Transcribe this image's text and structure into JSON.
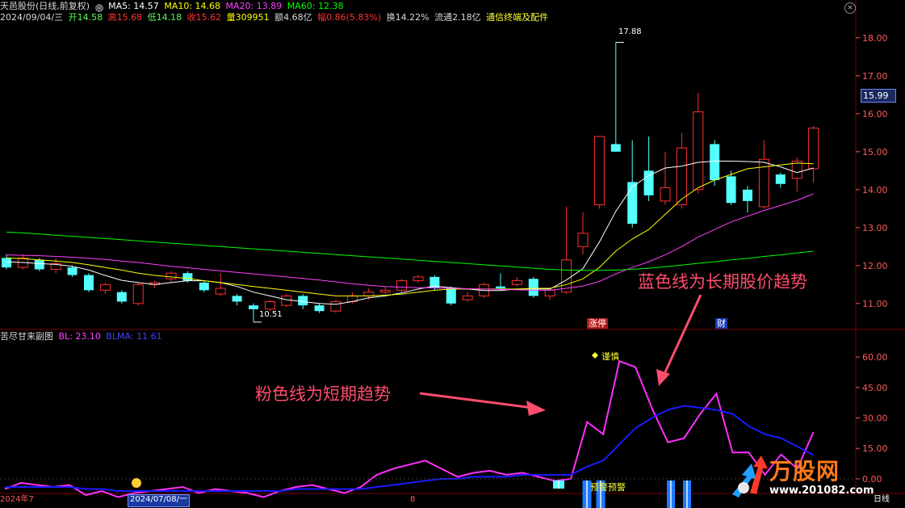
{
  "header": {
    "stock_name": "天邑股份(日线,前复权)",
    "ma5": "MA5: 14.57",
    "ma10": "MA10: 14.68",
    "ma20": "MA20: 13.89",
    "ma60": "MA60: 12.38",
    "date": "2024/09/04/三",
    "open": "开14.58",
    "high": "高15.68",
    "low": "低14.18",
    "close": "收15.62",
    "volume": "量309951",
    "amount": "额4.68亿",
    "change": "幅0.86(5.83%)",
    "turnover": "换14.22%",
    "float": "流通2.18亿",
    "sector": "通信终端及配件"
  },
  "sub_header": {
    "name": "苦尽甘来副图",
    "bl": "BL: 23.10",
    "blma": "BLMA: 11.61"
  },
  "labels": {
    "high_price": "17.88",
    "low_price": "10.51",
    "current_price": "15.99",
    "limit_up": "涨停",
    "finance": "财",
    "caution": "谨慎",
    "warning": "预警预警",
    "annot_blue": "蓝色线为长期股价趋势",
    "annot_pink": "粉色线为短期趋势",
    "close_symbol": "×",
    "ma_dot": "○"
  },
  "axis_bottom": {
    "date1": "2024年7",
    "date2": "2024/07/08/一",
    "date3": "8",
    "period": "日线"
  },
  "logo": {
    "text": "万股网",
    "url": "www.201082.com"
  },
  "colors": {
    "ma5": "#ffffff",
    "ma10": "#ffff00",
    "ma20": "#ff40ff",
    "ma60": "#00ff00",
    "up": "#ff3030",
    "down": "#54ffff",
    "bl": "#ff30ff",
    "blma": "#1a1aff",
    "grid": "#7a0000",
    "axis_text": "#ff5a5a"
  },
  "chart_data": [
    {
      "type": "candlestick",
      "title": "天邑股份(日线,前复权)",
      "y_ticks": [
        11.0,
        12.0,
        13.0,
        14.0,
        15.0,
        16.0,
        17.0,
        18.0
      ],
      "ylim": [
        10.4,
        18.4
      ],
      "candles": [
        {
          "o": 12.2,
          "c": 11.95,
          "h": 12.3,
          "l": 11.9
        },
        {
          "o": 11.95,
          "c": 12.2,
          "h": 12.3,
          "l": 11.9
        },
        {
          "o": 12.15,
          "c": 11.9,
          "h": 12.2,
          "l": 11.85
        },
        {
          "o": 11.9,
          "c": 12.05,
          "h": 12.2,
          "l": 11.8
        },
        {
          "o": 11.95,
          "c": 11.75,
          "h": 12.0,
          "l": 11.7
        },
        {
          "o": 11.75,
          "c": 11.35,
          "h": 11.8,
          "l": 11.3
        },
        {
          "o": 11.35,
          "c": 11.5,
          "h": 11.55,
          "l": 11.25
        },
        {
          "o": 11.3,
          "c": 11.05,
          "h": 11.35,
          "l": 11.0
        },
        {
          "o": 11.0,
          "c": 11.5,
          "h": 11.55,
          "l": 10.95
        },
        {
          "o": 11.5,
          "c": 11.55,
          "h": 11.6,
          "l": 11.4
        },
        {
          "o": 11.65,
          "c": 11.8,
          "h": 11.85,
          "l": 11.55
        },
        {
          "o": 11.8,
          "c": 11.6,
          "h": 11.85,
          "l": 11.55
        },
        {
          "o": 11.55,
          "c": 11.35,
          "h": 11.6,
          "l": 11.3
        },
        {
          "o": 11.25,
          "c": 11.4,
          "h": 11.8,
          "l": 11.2
        },
        {
          "o": 11.2,
          "c": 11.05,
          "h": 11.25,
          "l": 10.95
        },
        {
          "o": 10.95,
          "c": 10.85,
          "h": 11.0,
          "l": 10.51
        },
        {
          "o": 10.85,
          "c": 11.05,
          "h": 11.1,
          "l": 10.8
        },
        {
          "o": 10.95,
          "c": 11.2,
          "h": 11.25,
          "l": 10.9
        },
        {
          "o": 11.2,
          "c": 10.95,
          "h": 11.25,
          "l": 10.85
        },
        {
          "o": 10.95,
          "c": 10.8,
          "h": 11.0,
          "l": 10.75
        },
        {
          "o": 10.8,
          "c": 11.05,
          "h": 11.1,
          "l": 10.75
        },
        {
          "o": 11.05,
          "c": 11.2,
          "h": 11.3,
          "l": 11.0
        },
        {
          "o": 11.2,
          "c": 11.3,
          "h": 11.4,
          "l": 11.1
        },
        {
          "o": 11.3,
          "c": 11.35,
          "h": 11.45,
          "l": 11.25
        },
        {
          "o": 11.35,
          "c": 11.6,
          "h": 11.65,
          "l": 11.3
        },
        {
          "o": 11.6,
          "c": 11.7,
          "h": 11.75,
          "l": 11.55
        },
        {
          "o": 11.7,
          "c": 11.4,
          "h": 11.75,
          "l": 11.35
        },
        {
          "o": 11.4,
          "c": 11.0,
          "h": 11.45,
          "l": 10.95
        },
        {
          "o": 11.1,
          "c": 11.2,
          "h": 11.3,
          "l": 11.05
        },
        {
          "o": 11.2,
          "c": 11.5,
          "h": 11.55,
          "l": 11.15
        },
        {
          "o": 11.45,
          "c": 11.4,
          "h": 11.8,
          "l": 11.35
        },
        {
          "o": 11.5,
          "c": 11.6,
          "h": 11.7,
          "l": 11.45
        },
        {
          "o": 11.65,
          "c": 11.2,
          "h": 11.7,
          "l": 11.15
        },
        {
          "o": 11.2,
          "c": 11.35,
          "h": 11.4,
          "l": 11.1
        },
        {
          "o": 11.3,
          "c": 12.15,
          "h": 13.55,
          "l": 11.25
        },
        {
          "o": 12.5,
          "c": 12.85,
          "h": 13.4,
          "l": 12.3
        },
        {
          "o": 13.6,
          "c": 15.4,
          "h": 15.4,
          "l": 13.5
        },
        {
          "o": 15.2,
          "c": 15.0,
          "h": 17.88,
          "l": 15.0
        },
        {
          "o": 14.2,
          "c": 13.1,
          "h": 15.3,
          "l": 13.0
        },
        {
          "o": 14.5,
          "c": 13.85,
          "h": 15.4,
          "l": 13.7
        },
        {
          "o": 13.7,
          "c": 14.05,
          "h": 15.0,
          "l": 13.6
        },
        {
          "o": 13.6,
          "c": 15.1,
          "h": 15.5,
          "l": 13.5
        },
        {
          "o": 14.0,
          "c": 16.05,
          "h": 16.55,
          "l": 13.9
        },
        {
          "o": 15.2,
          "c": 14.25,
          "h": 15.3,
          "l": 14.1
        },
        {
          "o": 14.35,
          "c": 13.65,
          "h": 14.5,
          "l": 13.6
        },
        {
          "o": 14.0,
          "c": 13.7,
          "h": 14.1,
          "l": 13.4
        },
        {
          "o": 13.55,
          "c": 14.8,
          "h": 15.3,
          "l": 13.5
        },
        {
          "o": 14.4,
          "c": 14.15,
          "h": 14.45,
          "l": 14.05
        },
        {
          "o": 14.3,
          "c": 14.75,
          "h": 14.85,
          "l": 13.95
        },
        {
          "o": 14.55,
          "c": 15.62,
          "h": 15.68,
          "l": 14.18
        }
      ],
      "series": [
        {
          "name": "MA5",
          "values": [
            12.1,
            12.08,
            12.05,
            12.03,
            11.98,
            11.88,
            11.74,
            11.61,
            11.55,
            11.5,
            11.55,
            11.6,
            11.6,
            11.55,
            11.45,
            11.3,
            11.2,
            11.1,
            11.05,
            11.0,
            10.98,
            11.05,
            11.15,
            11.2,
            11.28,
            11.38,
            11.46,
            11.42,
            11.38,
            11.34,
            11.34,
            11.38,
            11.38,
            11.38,
            11.62,
            11.92,
            12.62,
            13.43,
            14.07,
            14.37,
            14.57,
            14.62,
            14.72,
            14.75,
            14.75,
            14.74,
            14.72,
            14.6,
            14.45,
            14.57
          ]
        },
        {
          "name": "MA10",
          "values": [
            12.2,
            12.18,
            12.15,
            12.12,
            12.08,
            12.02,
            11.95,
            11.88,
            11.8,
            11.74,
            11.7,
            11.66,
            11.6,
            11.55,
            11.5,
            11.45,
            11.4,
            11.35,
            11.3,
            11.25,
            11.2,
            11.2,
            11.2,
            11.22,
            11.25,
            11.3,
            11.35,
            11.38,
            11.38,
            11.38,
            11.38,
            11.38,
            11.4,
            11.4,
            11.5,
            11.65,
            11.95,
            12.38,
            12.7,
            12.95,
            13.35,
            13.75,
            14.05,
            14.25,
            14.4,
            14.55,
            14.6,
            14.65,
            14.7,
            14.68
          ]
        },
        {
          "name": "MA20",
          "values": [
            12.28,
            12.27,
            12.26,
            12.24,
            12.22,
            12.19,
            12.16,
            12.12,
            12.08,
            12.03,
            11.98,
            11.94,
            11.9,
            11.86,
            11.82,
            11.78,
            11.74,
            11.7,
            11.66,
            11.62,
            11.57,
            11.52,
            11.48,
            11.45,
            11.43,
            11.42,
            11.41,
            11.4,
            11.39,
            11.38,
            11.37,
            11.36,
            11.35,
            11.35,
            11.4,
            11.46,
            11.58,
            11.78,
            11.95,
            12.1,
            12.28,
            12.5,
            12.75,
            12.95,
            13.15,
            13.3,
            13.45,
            13.58,
            13.72,
            13.89
          ]
        },
        {
          "name": "MA60",
          "values": [
            12.88,
            12.86,
            12.83,
            12.8,
            12.77,
            12.74,
            12.71,
            12.68,
            12.65,
            12.62,
            12.59,
            12.56,
            12.53,
            12.5,
            12.47,
            12.44,
            12.41,
            12.38,
            12.35,
            12.32,
            12.29,
            12.26,
            12.23,
            12.2,
            12.17,
            12.14,
            12.11,
            12.08,
            12.05,
            12.02,
            11.99,
            11.96,
            11.93,
            11.9,
            11.88,
            11.87,
            11.87,
            11.88,
            11.9,
            11.93,
            11.97,
            12.01,
            12.06,
            12.1,
            12.15,
            12.19,
            12.24,
            12.28,
            12.33,
            12.38
          ]
        }
      ]
    },
    {
      "type": "line",
      "title": "苦尽甘来副图",
      "y_ticks": [
        0.0,
        15.0,
        30.0,
        45.0,
        60.0
      ],
      "ylim": [
        -6,
        68
      ],
      "series": [
        {
          "name": "BL",
          "values": [
            -5,
            -2,
            -3,
            -4,
            -3,
            -8,
            -6,
            -9,
            -7,
            -6,
            -5,
            -4,
            -7,
            -5,
            -6,
            -7,
            -9,
            -6,
            -4,
            -3,
            -5,
            -7,
            -4,
            2,
            5,
            7,
            9,
            5,
            1,
            3,
            4,
            2,
            3,
            1,
            -1,
            0,
            28,
            22,
            58,
            55,
            35,
            18,
            20,
            32,
            42,
            13,
            13,
            2,
            12,
            5,
            23.1
          ]
        },
        {
          "name": "BLMA",
          "values": [
            -4,
            -4,
            -4,
            -4,
            -4,
            -5,
            -5,
            -6,
            -6,
            -6,
            -6,
            -6,
            -6,
            -6,
            -6,
            -6,
            -6,
            -6,
            -5,
            -5,
            -5,
            -5,
            -5,
            -4,
            -3,
            -2,
            -1,
            0,
            0,
            1,
            1,
            1,
            2,
            2,
            2,
            2,
            6,
            9,
            17,
            25,
            30,
            34,
            36,
            35,
            34,
            32,
            26,
            22,
            20,
            16,
            11.61
          ]
        }
      ]
    }
  ]
}
